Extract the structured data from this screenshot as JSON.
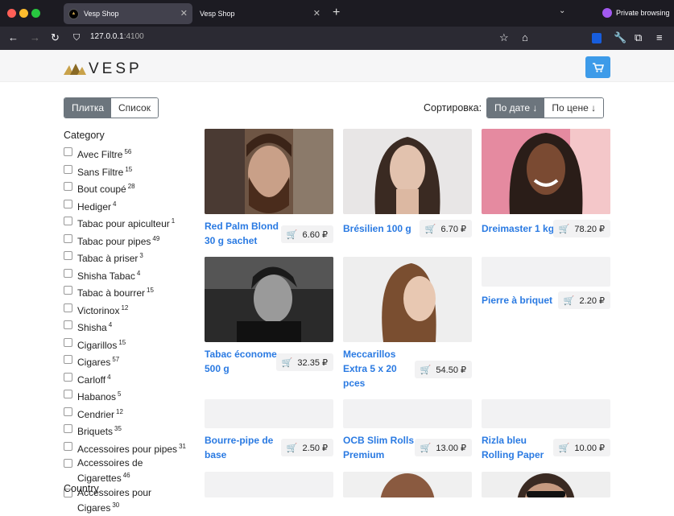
{
  "browser": {
    "tabs": [
      {
        "title": "Vesp Shop",
        "active": true
      },
      {
        "title": "Vesp Shop",
        "active": false
      }
    ],
    "private_label": "Private browsing",
    "url_host": "127.0.0.1",
    "url_port": ":4100"
  },
  "shop": {
    "logo_text": "VESP",
    "view": {
      "grid_label": "Плитка",
      "list_label": "Список"
    },
    "sort": {
      "label": "Сортировка:",
      "by_date": "По дате ↓",
      "by_price": "По цене ↓"
    },
    "category_title": "Category",
    "categories": [
      {
        "label": "Avec Filtre",
        "count": "56"
      },
      {
        "label": "Sans Filtre",
        "count": "15"
      },
      {
        "label": "Bout coupé",
        "count": "28"
      },
      {
        "label": "Hediger",
        "count": "4"
      },
      {
        "label": "Tabac pour apiculteur",
        "count": "1"
      },
      {
        "label": "Tabac pour pipes",
        "count": "49"
      },
      {
        "label": "Tabac à priser",
        "count": "3"
      },
      {
        "label": "Shisha Tabac",
        "count": "4"
      },
      {
        "label": "Tabac à bourrer",
        "count": "15"
      },
      {
        "label": "Victorinox",
        "count": "12"
      },
      {
        "label": "Shisha",
        "count": "4"
      },
      {
        "label": "Cigarillos",
        "count": "15"
      },
      {
        "label": "Cigares",
        "count": "57"
      },
      {
        "label": "Carloff",
        "count": "4"
      },
      {
        "label": "Habanos",
        "count": "5"
      },
      {
        "label": "Cendrier",
        "count": "12"
      },
      {
        "label": "Briquets",
        "count": "35"
      },
      {
        "label": "Accessoires pour pipes",
        "count": "31"
      },
      {
        "label": "Accessoires de Cigarettes",
        "count": "46"
      },
      {
        "label": "Accessoires pour Cigares",
        "count": "30"
      }
    ],
    "country_title": "Country",
    "products": [
      {
        "name": "Red Palm Blond 30 g sachet",
        "price": "6.60 ₽"
      },
      {
        "name": "Brésilien 100 g",
        "price": "6.70 ₽"
      },
      {
        "name": "Dreimaster 1 kg",
        "price": "78.20 ₽"
      },
      {
        "name": "Tabac économe 500 g",
        "price": "32.35 ₽"
      },
      {
        "name": "Meccarillos Extra 5 x 20 pces",
        "price": "54.50 ₽"
      },
      {
        "name": "Pierre à briquet",
        "price": "2.20 ₽"
      },
      {
        "name": "Bourre-pipe de base",
        "price": "2.50 ₽"
      },
      {
        "name": "OCB Slim Rolls Premium",
        "price": "13.00 ₽"
      },
      {
        "name": "Rizla bleu Rolling Paper",
        "price": "10.00 ₽"
      }
    ]
  },
  "colors": {
    "accent": "#2a7ae2",
    "cart": "#3d9be9",
    "active_btn": "#6c757d"
  }
}
